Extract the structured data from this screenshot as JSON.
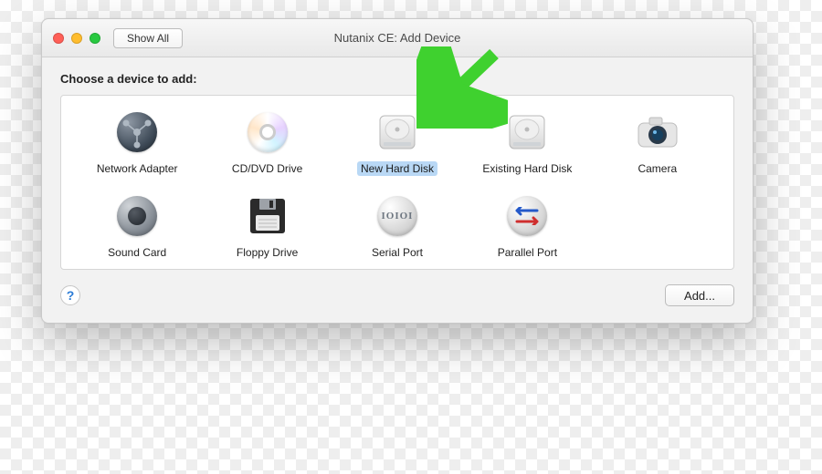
{
  "titlebar": {
    "show_all_label": "Show All",
    "window_title": "Nutanix CE: Add Device"
  },
  "prompt": "Choose a device to add:",
  "devices": [
    {
      "id": "network-adapter",
      "label": "Network Adapter",
      "icon": "network-adapter-icon",
      "selected": false
    },
    {
      "id": "cddvd-drive",
      "label": "CD/DVD Drive",
      "icon": "cd-drive-icon",
      "selected": false
    },
    {
      "id": "new-hard-disk",
      "label": "New Hard Disk",
      "icon": "hard-disk-icon",
      "selected": true
    },
    {
      "id": "existing-hard-disk",
      "label": "Existing Hard Disk",
      "icon": "hard-disk-icon",
      "selected": false
    },
    {
      "id": "camera",
      "label": "Camera",
      "icon": "camera-icon",
      "selected": false
    },
    {
      "id": "sound-card",
      "label": "Sound Card",
      "icon": "speaker-icon",
      "selected": false
    },
    {
      "id": "floppy-drive",
      "label": "Floppy Drive",
      "icon": "floppy-icon",
      "selected": false
    },
    {
      "id": "serial-port",
      "label": "Serial Port",
      "icon": "serial-port-icon",
      "selected": false
    },
    {
      "id": "parallel-port",
      "label": "Parallel Port",
      "icon": "parallel-port-icon",
      "selected": false
    }
  ],
  "footer": {
    "help_label": "?",
    "add_label": "Add..."
  },
  "annotation": {
    "arrow_color": "#3fd12f",
    "points_to": "new-hard-disk"
  }
}
